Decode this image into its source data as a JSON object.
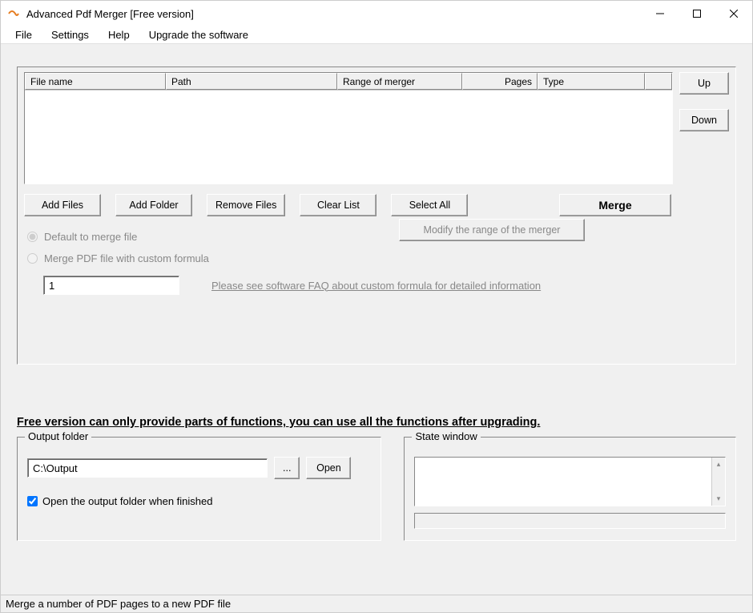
{
  "window": {
    "title": "Advanced Pdf Merger [Free version]"
  },
  "menu": {
    "file": "File",
    "settings": "Settings",
    "help": "Help",
    "upgrade": "Upgrade the software"
  },
  "columns": {
    "filename": "File name",
    "path": "Path",
    "range": "Range of merger",
    "pages": "Pages",
    "type": "Type"
  },
  "buttons": {
    "up": "Up",
    "down": "Down",
    "add_files": "Add Files",
    "add_folder": "Add Folder",
    "remove_files": "Remove Files",
    "clear_list": "Clear List",
    "select_all": "Select All",
    "merge": "Merge",
    "modify_range": "Modify the range of the merger",
    "browse": "...",
    "open": "Open"
  },
  "options": {
    "default_merge": "Default to merge file",
    "custom_formula": "Merge PDF file with custom formula",
    "formula_value": "1",
    "faq_link": "Please see software FAQ about custom formula for detailed information"
  },
  "notice": "Free version can only provide parts of functions, you can use all the functions after upgrading.",
  "output": {
    "legend": "Output folder",
    "path": "C:\\Output",
    "checkbox": "Open the output folder when finished"
  },
  "state": {
    "legend": "State window"
  },
  "statusbar": "Merge a number of PDF pages to a new PDF file"
}
